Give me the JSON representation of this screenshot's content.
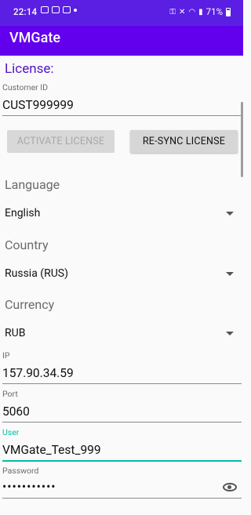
{
  "status": {
    "time": "22:14",
    "battery": "71%"
  },
  "app": {
    "title": "VMGate"
  },
  "license": {
    "section_title": "License:",
    "customer_id_label": "Customer ID",
    "customer_id_value": "CUST999999",
    "activate_label": "ACTIVATE LICENSE",
    "resync_label": "RE-SYNC LICENSE"
  },
  "language": {
    "label": "Language",
    "selected": "English"
  },
  "country": {
    "label": "Country",
    "selected": "Russia (RUS)"
  },
  "currency": {
    "label": "Currency",
    "selected": "RUB"
  },
  "network": {
    "ip_label": "IP",
    "ip_value": "157.90.34.59",
    "port_label": "Port",
    "port_value": "5060",
    "user_label": "User",
    "user_value": "VMGate_Test_999",
    "password_label": "Password",
    "password_value": "•••••••••••"
  },
  "colors": {
    "statusbar": "#5a1fe3",
    "appbar": "#6200ee",
    "accent_teal": "#00bfa5",
    "section_title": "#5316c7"
  }
}
